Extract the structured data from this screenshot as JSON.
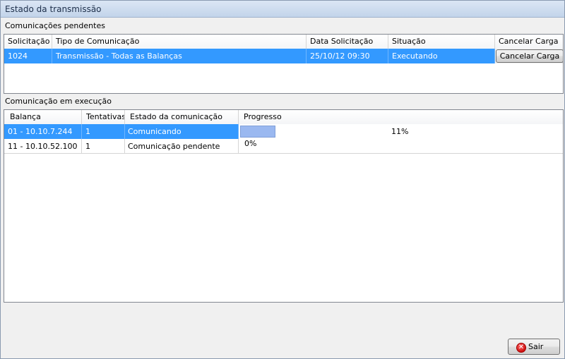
{
  "window": {
    "title": "Estado da transmissão"
  },
  "pending": {
    "label": "Comunicações pendentes",
    "columns": [
      "Solicitação",
      "Tipo de Comunicação",
      "Data Solicitação",
      "Situação",
      "Cancelar Carga"
    ],
    "rows": [
      {
        "solicitacao": "1024",
        "tipo": "Transmissão - Todas as Balanças",
        "data": "25/10/12 09:30",
        "situacao": "Executando",
        "cancel_label": "Cancelar Carga"
      }
    ]
  },
  "running": {
    "label": "Comunicação em execução",
    "columns": [
      "Balança",
      "Tentativas",
      "Estado da comunicação",
      "Progresso"
    ],
    "rows": [
      {
        "balanca": "01 - 10.10.7.244",
        "tentativas": "1",
        "estado": "Comunicando",
        "progress_text": "11%",
        "progress_value": 0.11
      },
      {
        "balanca": "11 - 10.10.52.100",
        "tentativas": "1",
        "estado": "Comunicação pendente",
        "progress_text": "0%",
        "progress_value": 0.0
      }
    ]
  },
  "footer": {
    "sair_label": "Sair",
    "sair_icon": "close-circle-icon"
  },
  "colors": {
    "selection": "#3399ff",
    "progress": "#9ab8f0"
  }
}
